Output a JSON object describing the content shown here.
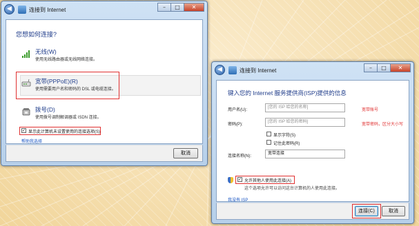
{
  "window1": {
    "title": "连接到 Internet",
    "heading": "您想如何连接?",
    "options": [
      {
        "title": "无线(W)",
        "desc": "使用无线路由器或无线网络连接。",
        "icon": "wireless-bars-icon"
      },
      {
        "title": "宽带(PPPoE)(R)",
        "desc": "使用需要用户名和密码的 DSL 或电缆连接。",
        "icon": "broadband-icon"
      },
      {
        "title": "拨号(D)",
        "desc": "使用拨号调制解调器或 ISDN 连接。",
        "icon": "phone-icon"
      }
    ],
    "show_options_label": "显示此计算机未设置使用的连接选项(S)",
    "help_link": "帮助我选择",
    "cancel_label": "取消"
  },
  "window2": {
    "title": "连接到 Internet",
    "heading": "键入您的 Internet 服务提供商(ISP)提供的信息",
    "username_label": "用户名(U):",
    "username_placeholder": "[您的 ISP 给您的名称]",
    "username_annotation": "宽带账号",
    "password_label": "密码(P):",
    "password_placeholder": "[您的 ISP 给您的密码]",
    "password_annotation": "宽带密码，区分大小写",
    "show_chars_label": "显示字符(S)",
    "remember_label": "记住此密码(R)",
    "connection_name_label": "连接名称(N):",
    "connection_name_value": "宽带连接",
    "allow_others_label": "允许其他人使用此连接(A)",
    "allow_others_desc": "这个选项允许可以访问这台计算机的人使用此连接。",
    "no_isp_link": "我没有 ISP",
    "connect_label": "连接(C)",
    "cancel_label": "取消"
  }
}
